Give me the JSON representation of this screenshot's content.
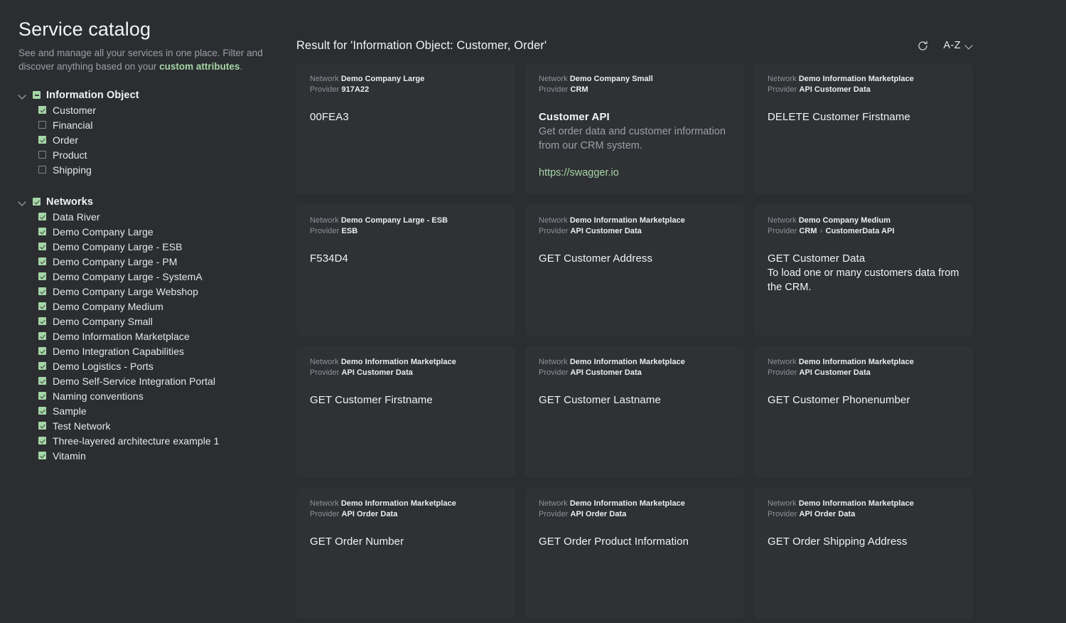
{
  "sidebar": {
    "title": "Service catalog",
    "subtitle_before": "See and manage all your services in one place. Filter and discover anything based on your ",
    "subtitle_link": "custom attributes",
    "subtitle_after": ".",
    "groups": [
      {
        "label": "Information Object",
        "state": "indeterminate",
        "items": [
          {
            "label": "Customer",
            "checked": true
          },
          {
            "label": "Financial",
            "checked": false
          },
          {
            "label": "Order",
            "checked": true
          },
          {
            "label": "Product",
            "checked": false
          },
          {
            "label": "Shipping",
            "checked": false
          }
        ]
      },
      {
        "label": "Networks",
        "state": "checked",
        "items": [
          {
            "label": "Data River",
            "checked": true
          },
          {
            "label": "Demo Company Large",
            "checked": true
          },
          {
            "label": "Demo Company Large - ESB",
            "checked": true
          },
          {
            "label": "Demo Company Large - PM",
            "checked": true
          },
          {
            "label": "Demo Company Large - SystemA",
            "checked": true
          },
          {
            "label": "Demo Company Large Webshop",
            "checked": true
          },
          {
            "label": "Demo Company Medium",
            "checked": true
          },
          {
            "label": "Demo Company Small",
            "checked": true
          },
          {
            "label": "Demo Information Marketplace",
            "checked": true
          },
          {
            "label": "Demo Integration Capabilities",
            "checked": true
          },
          {
            "label": "Demo Logistics - Ports",
            "checked": true
          },
          {
            "label": "Demo Self-Service Integration Portal",
            "checked": true
          },
          {
            "label": "Naming conventions",
            "checked": true
          },
          {
            "label": "Sample",
            "checked": true
          },
          {
            "label": "Test Network",
            "checked": true
          },
          {
            "label": "Three-layered architecture example 1",
            "checked": true
          },
          {
            "label": "Vitamin",
            "checked": true
          }
        ]
      }
    ]
  },
  "main": {
    "result_title": "Result for 'Information Object: Customer, Order'",
    "refresh_icon": "refresh-icon",
    "sort_label": "A-Z",
    "sort_caret_icon": "chevron-down-icon",
    "meta_labels": {
      "network": "Network",
      "provider": "Provider"
    },
    "cards": [
      {
        "network": "Demo Company Large",
        "provider": "917A22",
        "title": "00FEA3",
        "title_bold": false,
        "desc": "",
        "desc_light": false,
        "link": ""
      },
      {
        "network": "Demo Company Small",
        "provider": "CRM",
        "title": "Customer API",
        "title_bold": true,
        "desc": "Get order data and customer information from our CRM system.",
        "desc_light": false,
        "link": "https://swagger.io"
      },
      {
        "network": "Demo Information Marketplace",
        "provider": "API Customer Data",
        "title": "DELETE Customer Firstname",
        "title_bold": false,
        "desc": "",
        "desc_light": false,
        "link": ""
      },
      {
        "network": "Demo Company Large - ESB",
        "provider": "ESB",
        "title": "F534D4",
        "title_bold": false,
        "desc": "",
        "desc_light": false,
        "link": ""
      },
      {
        "network": "Demo Information Marketplace",
        "provider": "API Customer Data",
        "title": "GET Customer Address",
        "title_bold": false,
        "desc": "",
        "desc_light": false,
        "link": ""
      },
      {
        "network": "Demo Company Medium",
        "provider": "CRM",
        "provider_sub": "CustomerData API",
        "title": "GET Customer Data",
        "title_bold": false,
        "desc": "To load one or many customers data from the CRM.",
        "desc_light": true,
        "link": ""
      },
      {
        "network": "Demo Information Marketplace",
        "provider": "API Customer Data",
        "title": "GET Customer Firstname",
        "title_bold": false,
        "desc": "",
        "desc_light": false,
        "link": ""
      },
      {
        "network": "Demo Information Marketplace",
        "provider": "API Customer Data",
        "title": "GET Customer Lastname",
        "title_bold": false,
        "desc": "",
        "desc_light": false,
        "link": ""
      },
      {
        "network": "Demo Information Marketplace",
        "provider": "API Customer Data",
        "title": "GET Customer Phonenumber",
        "title_bold": false,
        "desc": "",
        "desc_light": false,
        "link": ""
      },
      {
        "network": "Demo Information Marketplace",
        "provider": "API Order Data",
        "title": "GET Order Number",
        "title_bold": false,
        "desc": "",
        "desc_light": false,
        "link": ""
      },
      {
        "network": "Demo Information Marketplace",
        "provider": "API Order Data",
        "title": "GET Order Product Information",
        "title_bold": false,
        "desc": "",
        "desc_light": false,
        "link": ""
      },
      {
        "network": "Demo Information Marketplace",
        "provider": "API Order Data",
        "title": "GET Order Shipping Address",
        "title_bold": false,
        "desc": "",
        "desc_light": false,
        "link": ""
      }
    ]
  },
  "colors": {
    "page_bg": "#2b2d30",
    "card_bg": "#2f3135",
    "accent_green": "#a5d6a7",
    "text_primary": "#f2f3f4",
    "text_muted": "#9ba0a6"
  }
}
